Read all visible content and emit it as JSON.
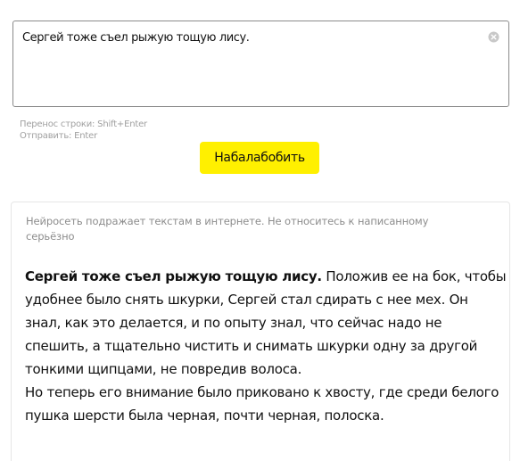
{
  "input": {
    "value": "Сергей тоже съел рыжую тощую лису."
  },
  "hints": {
    "line_break": "Перенос строки: Shift+Enter",
    "send": "Отправить: Enter"
  },
  "submit_button": {
    "label": "Набалабобить",
    "color": "#fff000"
  },
  "result": {
    "disclaimer_line1": "Нейросеть подражает текстам в интернете. Не относитесь к написанному",
    "disclaimer_line2": "серьёзно",
    "prompt_bold": "Сергей тоже съел рыжую тощую лису.",
    "continuation_part1": " Положив ее на бок, чтобы удобнее было снять шкурки, Сергей стал сдирать с нее мех. Он знал, как это делается, и по опыту знал, что сейчас надо не спешить, а тщательно чистить и снимать шкурки одну за другой тонкими щипцами, не повредив волоса.",
    "continuation_part2": "Но теперь его внимание было приковано к хвосту, где среди белого пушка шерсти была черная, почти черная, полоска."
  },
  "icons": {
    "clear": "close-circle-icon"
  }
}
